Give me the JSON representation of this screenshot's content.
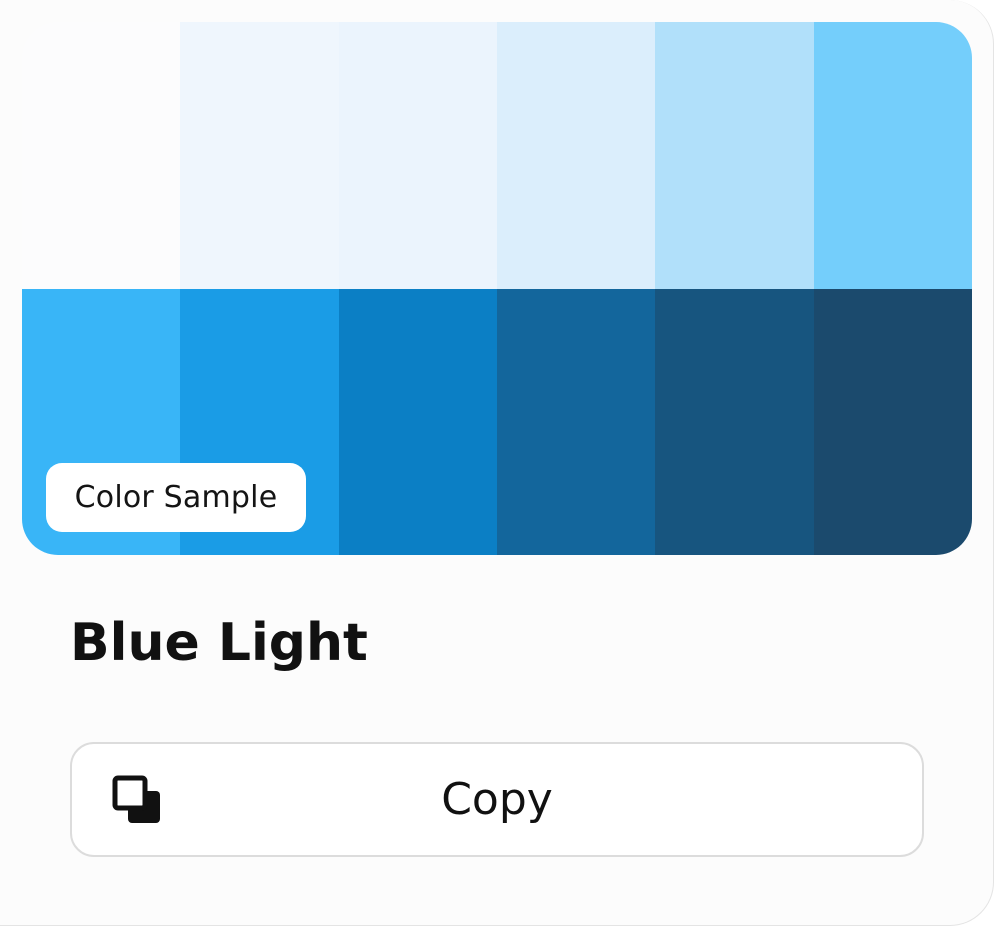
{
  "palette": {
    "name": "Blue Light",
    "badge_label": "Color Sample",
    "swatches": [
      "#fcfcfd",
      "#eff6fd",
      "#ebf4fd",
      "#dbeefc",
      "#b1e0fa",
      "#74cefb",
      "#39b5f7",
      "#1a9ce6",
      "#0b7fc5",
      "#13669c",
      "#17557f",
      "#1b4a6d"
    ]
  },
  "actions": {
    "copy_label": "Copy",
    "copy_icon": "copy-icon"
  }
}
